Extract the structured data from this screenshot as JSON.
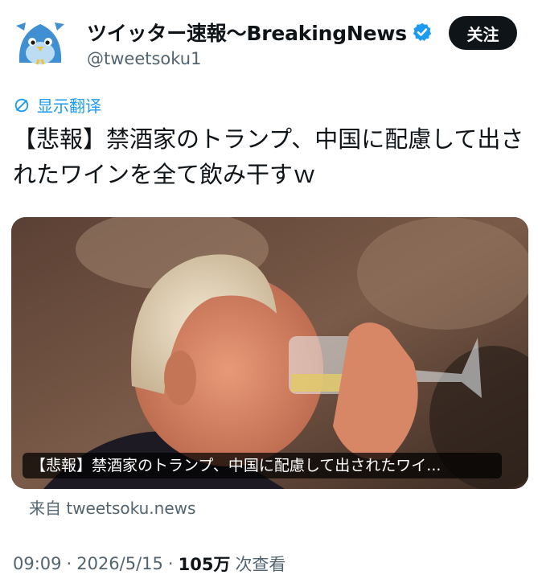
{
  "account": {
    "display_name": "ツイッター速報〜BreakingNews",
    "handle": "@tweetsoku1",
    "follow_label": "关注"
  },
  "translate_label": "显示翻译",
  "tweet": {
    "text": "【悲報】禁酒家のトランプ、中国に配慮して出されたワインを全て飲み干すｗ"
  },
  "card": {
    "caption": "【悲報】禁酒家のトランプ、中国に配慮して出されたワイ...",
    "source": "来自 tweetsoku.news"
  },
  "meta": {
    "time": "09:09",
    "date": "2026/5/15",
    "views": "105万",
    "views_label": "次查看"
  },
  "colors": {
    "accent": "#1d9bf0",
    "text": "#0f1419",
    "muted": "#536471",
    "button": "#0f1419"
  }
}
